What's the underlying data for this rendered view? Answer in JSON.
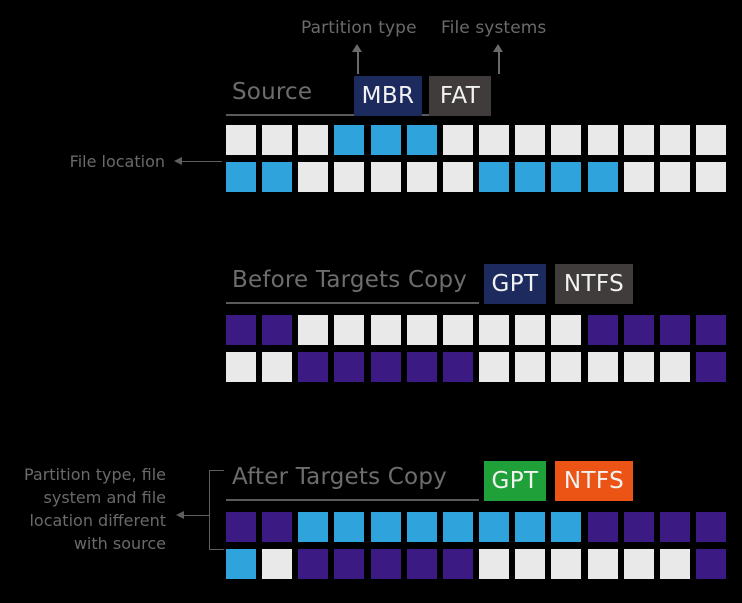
{
  "theme": {
    "background": "#000000",
    "empty_cell": "#e9e9e9",
    "blue_cell": "#2ea3dc",
    "purple_cell": "#3b1a84",
    "navy_badge": "#1c2a5e",
    "gray_badge": "#3f3c3b",
    "green_badge": "#20a038",
    "orange_badge": "#ec5415",
    "label_gray": "#6a6a6a",
    "rule_gray": "#5a5a5a"
  },
  "annotations": {
    "partition_type": "Partition type",
    "file_systems": "File systems",
    "file_location": "File location",
    "difference_note": "Partition type, file system and file location different with source"
  },
  "sections": [
    {
      "id": "source",
      "title": "Source",
      "badges": [
        {
          "label": "MBR",
          "color": "#1c2a5e"
        },
        {
          "label": "FAT",
          "color": "#3f3c3b"
        }
      ],
      "columns": 14,
      "rows": [
        [
          "empty",
          "empty",
          "empty",
          "blue",
          "blue",
          "blue",
          "empty",
          "empty",
          "empty",
          "empty",
          "empty",
          "empty",
          "empty",
          "empty"
        ],
        [
          "blue",
          "blue",
          "empty",
          "empty",
          "empty",
          "empty",
          "empty",
          "blue",
          "blue",
          "blue",
          "blue",
          "empty",
          "empty",
          "empty"
        ]
      ]
    },
    {
      "id": "before-targets-copy",
      "title": "Before Targets Copy",
      "badges": [
        {
          "label": "GPT",
          "color": "#1c2a5e"
        },
        {
          "label": "NTFS",
          "color": "#3f3c3b"
        }
      ],
      "columns": 14,
      "rows": [
        [
          "purple",
          "purple",
          "empty",
          "empty",
          "empty",
          "empty",
          "empty",
          "empty",
          "empty",
          "empty",
          "purple",
          "purple",
          "purple",
          "purple"
        ],
        [
          "empty",
          "empty",
          "purple",
          "purple",
          "purple",
          "purple",
          "purple",
          "empty",
          "empty",
          "empty",
          "empty",
          "empty",
          "empty",
          "purple"
        ]
      ]
    },
    {
      "id": "after-targets-copy",
      "title": "After Targets Copy",
      "badges": [
        {
          "label": "GPT",
          "color": "#20a038"
        },
        {
          "label": "NTFS",
          "color": "#ec5415"
        }
      ],
      "columns": 14,
      "rows": [
        [
          "purple",
          "purple",
          "blue",
          "blue",
          "blue",
          "blue",
          "blue",
          "blue",
          "blue",
          "blue",
          "purple",
          "purple",
          "purple",
          "purple"
        ],
        [
          "blue",
          "empty",
          "purple",
          "purple",
          "purple",
          "purple",
          "purple",
          "empty",
          "empty",
          "empty",
          "empty",
          "empty",
          "empty",
          "purple"
        ]
      ]
    }
  ]
}
